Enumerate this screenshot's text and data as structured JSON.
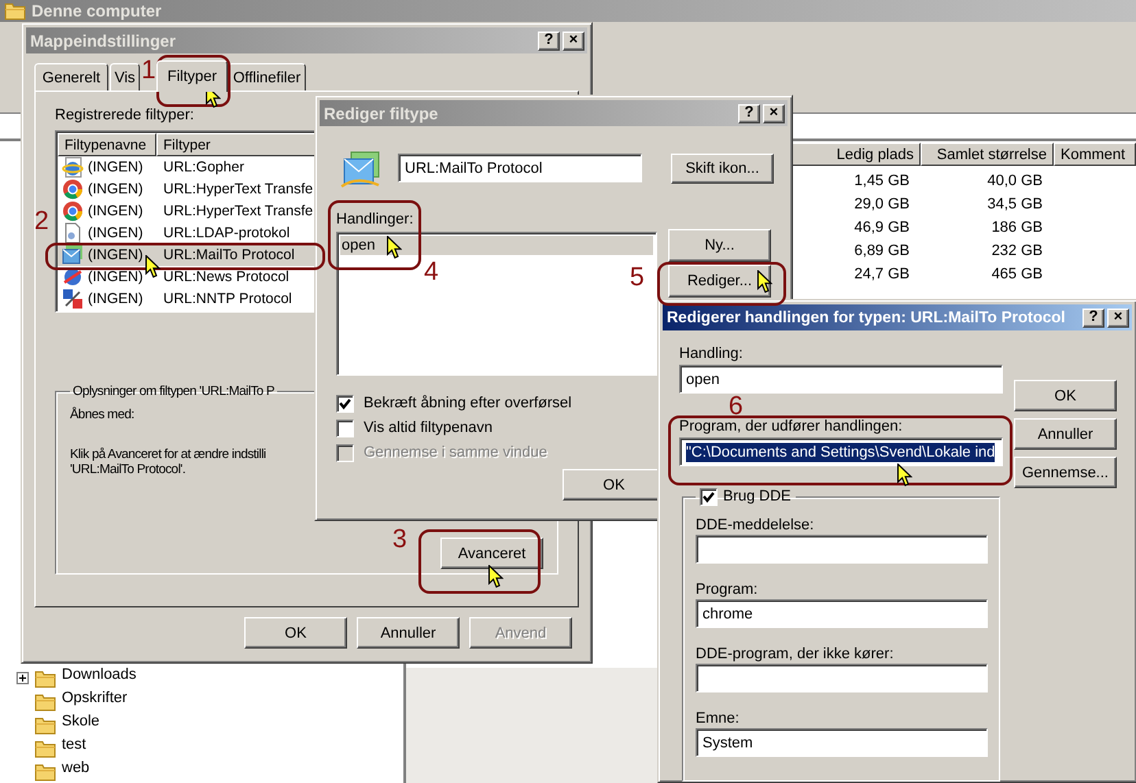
{
  "explorer": {
    "title": "Denne computer",
    "columns": [
      "Ledig plads",
      "Samlet størrelse",
      "Komment"
    ],
    "rows": [
      {
        "free": "1,45 GB",
        "total": "40,0 GB"
      },
      {
        "free": "29,0 GB",
        "total": "34,5 GB"
      },
      {
        "free": "46,9 GB",
        "total": "186 GB"
      },
      {
        "free": "6,89 GB",
        "total": "232 GB"
      },
      {
        "free": "24,7 GB",
        "total": "465 GB"
      }
    ],
    "tree": [
      {
        "label": "Downloads",
        "expandable": true
      },
      {
        "label": "Opskrifter",
        "expandable": false
      },
      {
        "label": "Skole",
        "expandable": false
      },
      {
        "label": "test",
        "expandable": false
      },
      {
        "label": "web",
        "expandable": false
      }
    ]
  },
  "folder_options": {
    "title": "Mappeindstillinger",
    "title_buttons": [
      "?",
      "×"
    ],
    "tabs": [
      {
        "label": "Generelt",
        "selected": false
      },
      {
        "label": "Vis",
        "selected": false
      },
      {
        "label": "Filtyper",
        "selected": true
      },
      {
        "label": "Offlinefiler",
        "selected": false
      }
    ],
    "list_label": "Registrerede filtyper:",
    "columns": [
      "Filtypenavne",
      "Filtyper"
    ],
    "rows": [
      {
        "extension": "(INGEN)",
        "type": "URL:Gopher",
        "selected": false
      },
      {
        "extension": "(INGEN)",
        "type": "URL:HyperText Transfe",
        "selected": false
      },
      {
        "extension": "(INGEN)",
        "type": "URL:HyperText Transfe",
        "selected": false
      },
      {
        "extension": "(INGEN)",
        "type": "URL:LDAP-protokol",
        "selected": false
      },
      {
        "extension": "(INGEN)",
        "type": "URL:MailTo Protocol",
        "selected": true
      },
      {
        "extension": "(INGEN)",
        "type": "URL:News Protocol",
        "selected": false
      },
      {
        "extension": "(INGEN)",
        "type": "URL:NNTP Protocol",
        "selected": false
      }
    ],
    "details_title": "Oplysninger om filtypen 'URL:MailTo P",
    "opens_with_label": "Åbnes med:",
    "details_text": "Klik på Avanceret for at ændre indstilli",
    "details_text_2": "'URL:MailTo Protocol'.",
    "advanced_button": "Avanceret",
    "buttons": [
      {
        "label": "OK",
        "disabled": false
      },
      {
        "label": "Annuller",
        "disabled": false
      },
      {
        "label": "Anvend",
        "disabled": true
      }
    ]
  },
  "edit_file_type": {
    "title": "Rediger filtype",
    "title_buttons": [
      "?",
      "×"
    ],
    "name_value": "URL:MailTo Protocol",
    "change_icon_button": "Skift ikon...",
    "actions_label": "Handlinger:",
    "actions": [
      {
        "label": "open",
        "selected": true
      }
    ],
    "new_button": "Ny...",
    "edit_button": "Rediger...",
    "options": [
      {
        "label": "Bekræft åbning efter overførsel",
        "checked": true,
        "disabled": false
      },
      {
        "label": "Vis altid filtypenavn",
        "checked": false,
        "disabled": false
      },
      {
        "label": "Gennemse i samme vindue",
        "checked": false,
        "disabled": true
      }
    ],
    "ok_button": "OK"
  },
  "edit_action": {
    "title": "Redigerer handlingen for typen: URL:MailTo Protocol",
    "title_buttons": [
      "?",
      "×"
    ],
    "action_label": "Handling:",
    "action_value": "open",
    "program_label": "Program, der udfører handlingen:",
    "program_value": "\"C:\\Documents and Settings\\Svend\\Lokale ind",
    "program_text_selected": true,
    "buttons": [
      "OK",
      "Annuller",
      "Gennemse..."
    ],
    "dde": {
      "label": "Brug DDE",
      "checked": true,
      "fields": [
        {
          "label": "DDE-meddelelse:"
        },
        {
          "label": "Program:",
          "value": "chrome"
        },
        {
          "label": "DDE-program, der ikke kører:"
        },
        {
          "label": "Emne:",
          "value": "System"
        }
      ]
    }
  },
  "annotations": [
    {
      "label": "1"
    },
    {
      "label": "2"
    },
    {
      "label": "3"
    },
    {
      "label": "4"
    },
    {
      "label": "5"
    },
    {
      "label": "6"
    }
  ]
}
